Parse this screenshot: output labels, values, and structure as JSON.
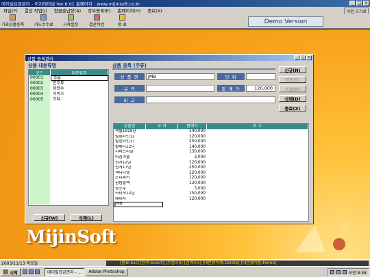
{
  "window": {
    "title": "데이빌요금관리 - 이지데이빌 Ver.6.01 홈페이지 : www.mijinsoft.co.kr",
    "controls": [
      "_",
      "□",
      "×"
    ]
  },
  "menu": {
    "items": [
      "파일(F)",
      "결산 작업(J)",
      "현금출납장(A)",
      "장부등록(E)",
      "홈페이지(H)",
      "종료(X)"
    ],
    "right_button": "이전 크기로"
  },
  "toolbar": {
    "buttons": [
      "기초상품등록",
      "카드수수료",
      "시작설정",
      "결산작업",
      "종 료"
    ]
  },
  "demo_label": "Demo Version",
  "logo_text": "MijinSoft",
  "child_window": {
    "title": "상품 등록관리",
    "category_section_title": "상품 대분류명",
    "category_headers": [
      "코드",
      "대분류명"
    ],
    "categories": [
      {
        "code": "00001",
        "name": "주류"
      },
      {
        "code": "00002",
        "name": "안주류"
      },
      {
        "code": "00003",
        "name": "음료수"
      },
      {
        "code": "00004",
        "name": "서비스"
      },
      {
        "code": "00005",
        "name": "기타"
      }
    ],
    "category_buttons": {
      "new": "신규(W)",
      "delete": "삭제(L)"
    },
    "product_section_title": "상품 등록 (주류)",
    "form": {
      "name_label": "상 품 명",
      "name_value": "JMB",
      "unit_label": "단 위",
      "unit_value": "",
      "spec_label": "규 격",
      "spec_value": "",
      "price_label": "판 매 가",
      "price_value": "120,000",
      "note_label": "비 고",
      "note_value": ""
    },
    "action_buttons": {
      "new": "신규(N)",
      "save": "저장(S)",
      "edit": "수정(M)",
      "delete": "삭제(D)",
      "close": "종료(X)"
    },
    "grid_headers": [
      "상품명",
      "규 격",
      "판매가",
      "비 고"
    ],
    "products": [
      {
        "name": "잭될1818년",
        "spec": "",
        "price": "140,000"
      },
      {
        "name": "발렌타인12",
        "spec": "",
        "price": "120,000"
      },
      {
        "name": "발렌타인17",
        "spec": "",
        "price": "250,000"
      },
      {
        "name": "발베니12년",
        "spec": "",
        "price": "140,000"
      },
      {
        "name": "시바스리갈",
        "spec": "",
        "price": "130,000"
      },
      {
        "name": "아침이슬",
        "spec": "",
        "price": "3,000"
      },
      {
        "name": "윈저12년",
        "spec": "",
        "price": "120,000"
      },
      {
        "name": "윈저17년",
        "spec": "",
        "price": "250,000"
      },
      {
        "name": "잭다니엘",
        "spec": "",
        "price": "120,000"
      },
      {
        "name": "조니워커",
        "spec": "",
        "price": "120,000"
      },
      {
        "name": "짐빔블랙",
        "spec": "",
        "price": "130,000"
      },
      {
        "name": "참소주",
        "spec": "",
        "price": "3,000"
      },
      {
        "name": "커티샥12년",
        "spec": "",
        "price": "150,000"
      },
      {
        "name": "헤네시",
        "spec": "",
        "price": "120,000"
      },
      {
        "name": "JMB",
        "spec": "",
        "price": ""
      }
    ]
  },
  "status": {
    "date": "2003/11/13 목요일",
    "keys": "[종료:Esc] [등록:Insert] [수정:F4] [검색:F3] [대분류삭제:Delete] [대분류이동:Home]"
  },
  "taskbar": {
    "start": "시작",
    "tasks": [
      "데이빌요금관리 - ...",
      "Adobe Photoshop"
    ],
    "clock": "오전 8:58"
  }
}
